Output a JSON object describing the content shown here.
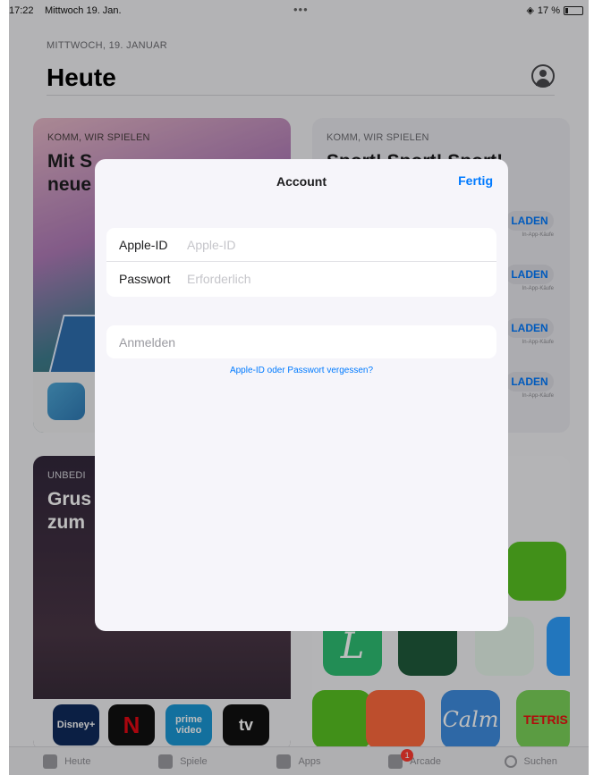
{
  "status_bar": {
    "time": "17:22",
    "date": "Mittwoch 19. Jan.",
    "dots": "•••",
    "battery": "17 %"
  },
  "today": {
    "date_label": "MITTWOCH, 19. JANUAR",
    "title": "Heute"
  },
  "cards": {
    "card1": {
      "kicker": "KOMM, WIR SPIELEN",
      "headline": "Mit S\nneue"
    },
    "card2": {
      "kicker": "KOMM, WIR SPIELEN",
      "headline": "Sport! Sport! Sport!",
      "get_label": "LADEN",
      "get_sub": "In-App-Käufe"
    },
    "card3": {
      "kicker": "UNBEDI",
      "headline": "Grus\nzum",
      "logos": {
        "disney": "Disney+",
        "netflix": "N",
        "prime": "prime video",
        "tv": "tv"
      }
    },
    "card4": {
      "calm": "Calm",
      "tetris": "TETRIS",
      "l": "L"
    }
  },
  "tabbar": {
    "items": [
      {
        "label": "Heute",
        "icon": "today-icon"
      },
      {
        "label": "Spiele",
        "icon": "rocket-icon"
      },
      {
        "label": "Apps",
        "icon": "apps-stack-icon"
      },
      {
        "label": "Arcade",
        "icon": "arcade-icon",
        "badge": "1"
      },
      {
        "label": "Suchen",
        "icon": "search-icon"
      }
    ]
  },
  "sheet": {
    "title": "Account",
    "done_label": "Fertig",
    "apple_id_label": "Apple-ID",
    "apple_id_placeholder": "Apple-ID",
    "password_label": "Passwort",
    "password_placeholder": "Erforderlich",
    "signin_label": "Anmelden",
    "forgot_label": "Apple-ID oder Passwort vergessen?"
  },
  "colors": {
    "accent": "#007aff",
    "badge": "#ff3b30"
  }
}
